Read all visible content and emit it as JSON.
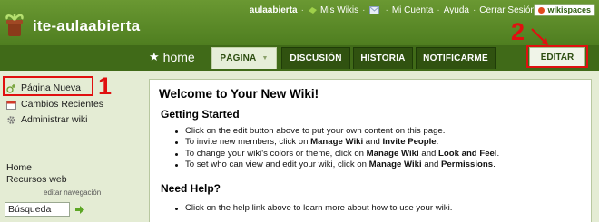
{
  "site": {
    "title": "ite-aulaabierta"
  },
  "user_bar": {
    "username": "aulaabierta",
    "my_wikis": "Mis Wikis",
    "my_account": "Mi Cuenta",
    "help": "Ayuda",
    "sign_out": "Cerrar Sesión",
    "brand": "wikispaces"
  },
  "nav": {
    "home": "home",
    "tabs": [
      "PÁGINA",
      "DISCUSIÓN",
      "HISTORIA",
      "NOTIFICARME"
    ],
    "edit": "EDITAR"
  },
  "annotations": {
    "one": "1",
    "two": "2"
  },
  "sidebar": {
    "new_page": "Página Nueva",
    "recent_changes": "Cambios Recientes",
    "manage_wiki": "Administrar wiki",
    "search_value": "Búsqueda",
    "home": "Home",
    "web_resources": "Recursos web",
    "edit_nav": "editar navegación"
  },
  "content": {
    "heading": "Welcome to Your New Wiki!",
    "getting_started": {
      "title": "Getting Started",
      "item1": "Click on the edit button above to put your own content on this page.",
      "item2_pre": "To invite new members, click on ",
      "item2_b1": "Manage Wiki",
      "item2_mid": " and ",
      "item2_b2": "Invite People",
      "item2_post": ".",
      "item3_pre": "To change your wiki's colors or theme, click on ",
      "item3_b1": "Manage Wiki",
      "item3_mid": " and ",
      "item3_b2": "Look and Feel",
      "item3_post": ".",
      "item4_pre": "To set who can view and edit your wiki, click on ",
      "item4_b1": "Manage Wiki",
      "item4_mid": " and ",
      "item4_b2": "Permissions",
      "item4_post": "."
    },
    "need_help": {
      "title": "Need Help?",
      "item1": "Click on the help link above to learn more about how to use your wiki."
    }
  },
  "colors": {
    "header": "#4f7e20",
    "tab_dark": "#305210",
    "annotation": "#e01010"
  }
}
